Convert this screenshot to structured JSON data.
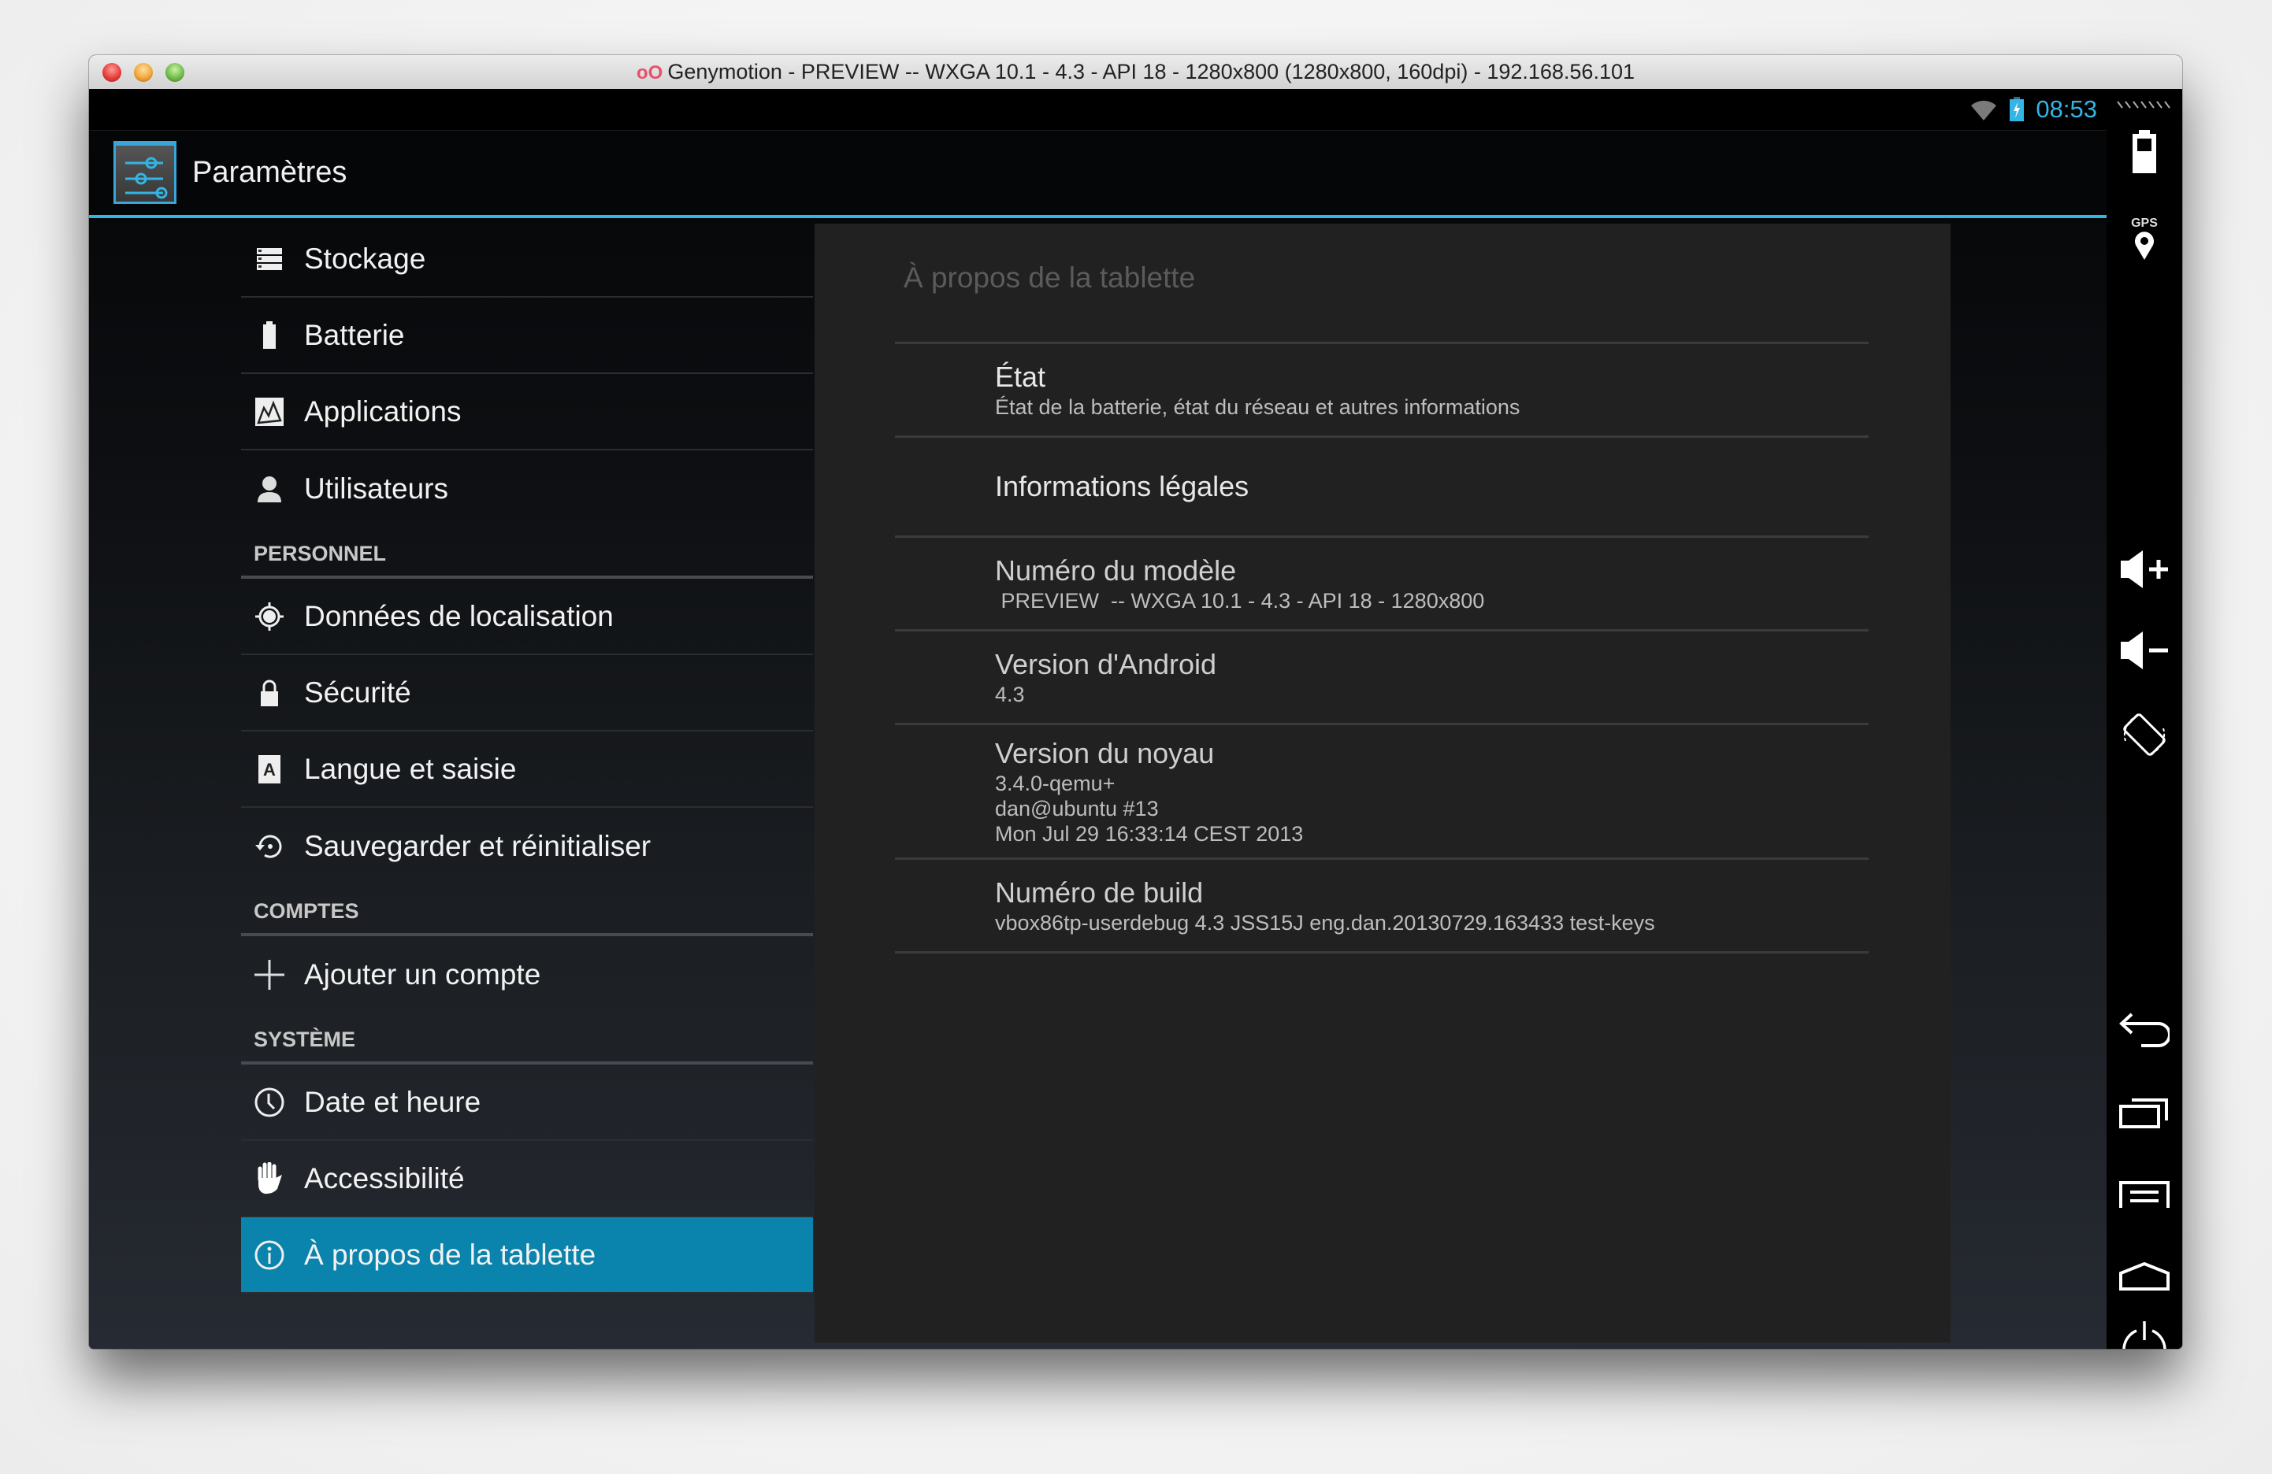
{
  "window": {
    "title": "Genymotion -  PREVIEW  -- WXGA 10.1 - 4.3 - API 18 - 1280x800 (1280x800, 160dpi) - 192.168.56.101",
    "logo_icon": "genymotion-logo-icon"
  },
  "statusbar": {
    "time": "08:53",
    "icons": [
      "wifi-icon",
      "battery-charging-icon"
    ]
  },
  "actionbar": {
    "title": "Paramètres",
    "icon": "settings-sliders-icon"
  },
  "sidebar": {
    "groups": [
      {
        "header": null,
        "items": [
          {
            "label": "Stockage",
            "icon": "storage-icon"
          },
          {
            "label": "Batterie",
            "icon": "battery-icon"
          },
          {
            "label": "Applications",
            "icon": "applications-icon"
          },
          {
            "label": "Utilisateurs",
            "icon": "user-icon"
          }
        ]
      },
      {
        "header": "PERSONNEL",
        "items": [
          {
            "label": "Données de localisation",
            "icon": "location-icon"
          },
          {
            "label": "Sécurité",
            "icon": "lock-icon"
          },
          {
            "label": "Langue et saisie",
            "icon": "language-icon"
          },
          {
            "label": "Sauvegarder et réinitialiser",
            "icon": "backup-restore-icon"
          }
        ]
      },
      {
        "header": "COMPTES",
        "items": [
          {
            "label": "Ajouter un compte",
            "icon": "plus-icon"
          }
        ]
      },
      {
        "header": "SYSTÈME",
        "items": [
          {
            "label": "Date et heure",
            "icon": "clock-icon"
          },
          {
            "label": "Accessibilité",
            "icon": "hand-icon"
          },
          {
            "label": "À propos de la tablette",
            "icon": "info-icon",
            "selected": true
          }
        ]
      }
    ]
  },
  "content": {
    "title": "À propos de la tablette",
    "prefs": [
      {
        "title": "État",
        "summary": "État de la batterie, état du réseau et autres informations"
      },
      {
        "title": "Informations légales",
        "summary": null
      },
      {
        "title": "Numéro du modèle",
        "summary": " PREVIEW  -- WXGA 10.1 - 4.3 - API 18 - 1280x800"
      },
      {
        "title": "Version d'Android",
        "summary": "4.3"
      },
      {
        "title": "Version du noyau",
        "summary": "3.4.0-qemu+\ndan@ubuntu #13\nMon Jul 29 16:33:14 CEST 2013"
      },
      {
        "title": "Numéro de build",
        "summary": "vbox86tp-userdebug 4.3 JSS15J eng.dan.20130729.163433 test-keys"
      }
    ]
  },
  "genymotion_toolbar": {
    "buttons": [
      {
        "name": "battery-widget",
        "icon": "battery-widget-icon"
      },
      {
        "name": "gps-widget",
        "label": "GPS",
        "icon": "gps-pin-icon"
      },
      {
        "name": "volume-up",
        "icon": "volume-up-icon"
      },
      {
        "name": "volume-down",
        "icon": "volume-down-icon"
      },
      {
        "name": "rotate",
        "icon": "rotate-device-icon"
      },
      {
        "name": "back",
        "icon": "back-icon"
      },
      {
        "name": "recent-apps",
        "icon": "recent-apps-icon"
      },
      {
        "name": "menu",
        "icon": "menu-icon"
      },
      {
        "name": "home",
        "icon": "home-icon"
      },
      {
        "name": "power",
        "icon": "power-icon"
      }
    ]
  },
  "colors": {
    "accent": "#33b5e5",
    "selected_row": "#0a84ad",
    "content_bg": "#212121",
    "divider": "#3b3b3b"
  }
}
